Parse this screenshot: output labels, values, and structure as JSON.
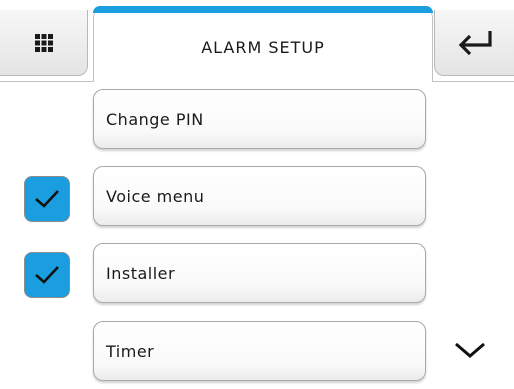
{
  "header": {
    "title": "ALARM SETUP",
    "menu_icon": "grid-menu-icon",
    "back_icon": "return-arrow-icon",
    "accent_color": "#1a9ee0"
  },
  "items": [
    {
      "label": "Change PIN",
      "checked": false
    },
    {
      "label": "Voice menu",
      "checked": true
    },
    {
      "label": "Installer",
      "checked": true
    },
    {
      "label": "Timer",
      "checked": false
    }
  ],
  "scroll": {
    "icon": "chevron-down-icon"
  }
}
